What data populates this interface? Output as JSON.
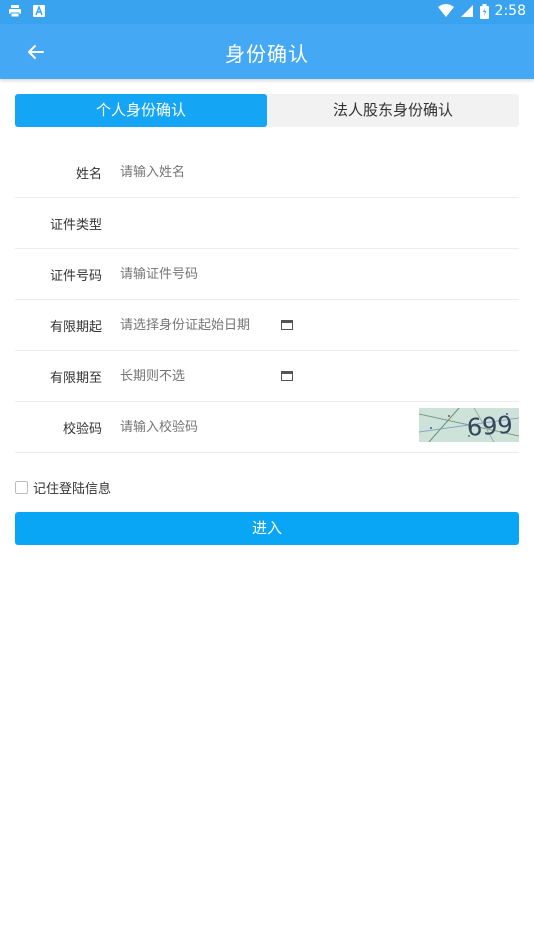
{
  "status_bar": {
    "time": "2:58",
    "icons": [
      "print-icon",
      "a-icon",
      "wifi-icon",
      "signal-icon",
      "battery-icon"
    ]
  },
  "header": {
    "title": "身份确认",
    "back_icon": "arrow-left-icon"
  },
  "tabs": [
    {
      "label": "个人身份确认",
      "active": true
    },
    {
      "label": "法人股东身份确认",
      "active": false
    }
  ],
  "form": {
    "name": {
      "label": "姓名",
      "placeholder": "请输入姓名"
    },
    "id_type": {
      "label": "证件类型",
      "value": ""
    },
    "id_number": {
      "label": "证件号码",
      "placeholder": "请输证件号码"
    },
    "valid_from": {
      "label": "有限期起",
      "placeholder": "请选择身份证起始日期"
    },
    "valid_to": {
      "label": "有限期至",
      "placeholder": "长期则不选"
    },
    "captcha": {
      "label": "校验码",
      "placeholder": "请输入校验码",
      "image_text": "699"
    }
  },
  "remember": {
    "label": "记住登陆信息",
    "checked": false
  },
  "submit": {
    "label": "进入"
  },
  "colors": {
    "appbar": "#45a8f4",
    "accent": "#0aa6f6"
  }
}
